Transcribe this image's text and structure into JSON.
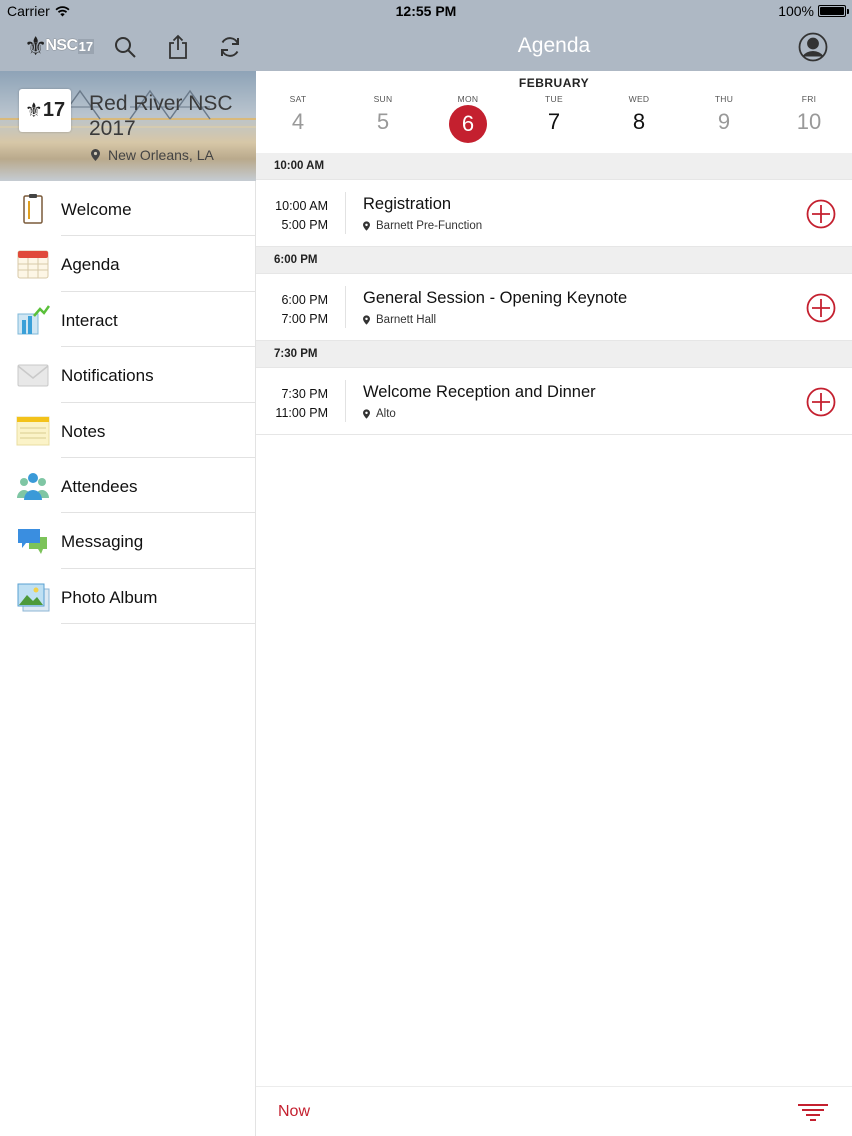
{
  "status_bar": {
    "carrier": "Carrier",
    "time": "12:55 PM",
    "battery": "100%"
  },
  "header": {
    "logo_text": "NSC",
    "logo_year": "17",
    "title": "Agenda"
  },
  "event": {
    "title": "Red River NSC 2017",
    "location": "New Orleans, LA",
    "logo_text": "17"
  },
  "sidebar": {
    "items": [
      {
        "label": "Welcome",
        "icon": "clipboard-icon"
      },
      {
        "label": "Agenda",
        "icon": "calendar-icon"
      },
      {
        "label": "Interact",
        "icon": "poll-icon"
      },
      {
        "label": "Notifications",
        "icon": "envelope-icon"
      },
      {
        "label": "Notes",
        "icon": "notepad-icon"
      },
      {
        "label": "Attendees",
        "icon": "people-icon"
      },
      {
        "label": "Messaging",
        "icon": "chat-icon"
      },
      {
        "label": "Photo Album",
        "icon": "photo-icon"
      }
    ]
  },
  "dates": {
    "month": "FEBRUARY",
    "days": [
      {
        "dow": "SAT",
        "num": "4"
      },
      {
        "dow": "SUN",
        "num": "5"
      },
      {
        "dow": "MON",
        "num": "6",
        "selected": true
      },
      {
        "dow": "TUE",
        "num": "7"
      },
      {
        "dow": "WED",
        "num": "8"
      },
      {
        "dow": "THU",
        "num": "9"
      },
      {
        "dow": "FRI",
        "num": "10"
      }
    ]
  },
  "agenda": {
    "groups": [
      {
        "header": "10:00 AM",
        "sessions": [
          {
            "start": "10:00 AM",
            "end": "5:00 PM",
            "title": "Registration",
            "room": "Barnett Pre-Function"
          }
        ]
      },
      {
        "header": "6:00 PM",
        "sessions": [
          {
            "start": "6:00 PM",
            "end": "7:00 PM",
            "title": "General Session - Opening Keynote",
            "room": "Barnett Hall"
          }
        ]
      },
      {
        "header": "7:30 PM",
        "sessions": [
          {
            "start": "7:30 PM",
            "end": "11:00 PM",
            "title": "Welcome Reception and Dinner",
            "room": "Alto"
          }
        ]
      }
    ]
  },
  "footer": {
    "now_label": "Now"
  },
  "colors": {
    "accent": "#c4202f",
    "toolbar": "#aeb8c4"
  }
}
